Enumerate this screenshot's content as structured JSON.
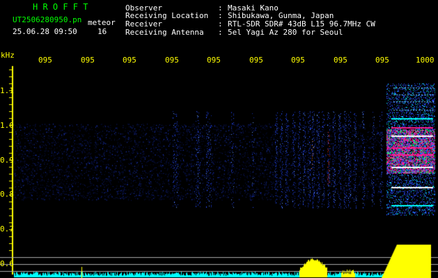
{
  "header": {
    "logo": "H R O F F T",
    "filename": "UT2506280950.pn",
    "meteor_label": "meteor",
    "datetime": "25.06.28 09:50",
    "count": "16",
    "fields": [
      {
        "label": "Observer",
        "value": "Masaki Kano"
      },
      {
        "label": "Receiving Location",
        "value": "Shibukawa, Gunma, Japan"
      },
      {
        "label": "Receiver",
        "value": "RTL-SDR SDR# 43dB L15 96.7MHz CW"
      },
      {
        "label": "Receiving Antenna",
        "value": "5el Yagi Az 280 for Seoul"
      }
    ],
    "separator": ":"
  },
  "axis": {
    "unit": "kHz",
    "y_ticks": [
      "1.1",
      "1.0",
      "0.9",
      "0.8",
      "0.7",
      "0.6"
    ],
    "time_ticks": [
      "095",
      "095",
      "095",
      "095",
      "095",
      "095",
      "095",
      "095",
      "095",
      "1000"
    ]
  },
  "colors": {
    "background": "#000000",
    "header_text": "#ffffff",
    "logo": "#00ff00",
    "axis_text": "#ffff00",
    "signal": "#2a4dff",
    "signal_strong": "#ff1a8c",
    "profile_cyan": "#00ffff",
    "profile_yellow": "#ffff00"
  }
}
